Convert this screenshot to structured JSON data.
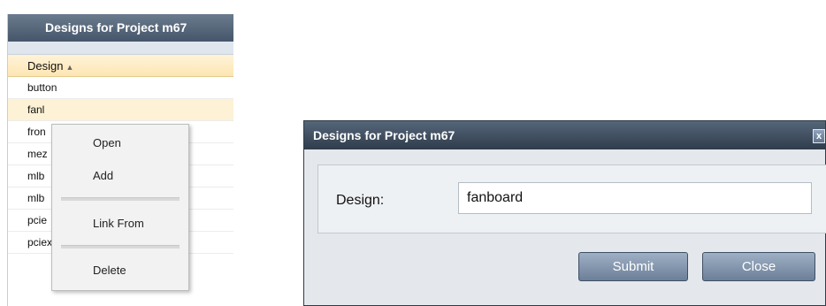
{
  "designs_panel": {
    "title": "Designs for Project m67",
    "column_header": "Design",
    "rows": [
      "button",
      "fanl",
      "fron",
      "mez",
      "mlb",
      "mlb",
      "pcie",
      "pciex16mbp"
    ]
  },
  "context_menu": {
    "items": [
      "Open",
      "Add",
      "Link From",
      "Delete"
    ]
  },
  "dialog": {
    "title": "Designs for Project m67",
    "close_glyph": "x",
    "field_label": "Design:",
    "field_value": "fanboard",
    "submit_label": "Submit",
    "close_label": "Close"
  }
}
